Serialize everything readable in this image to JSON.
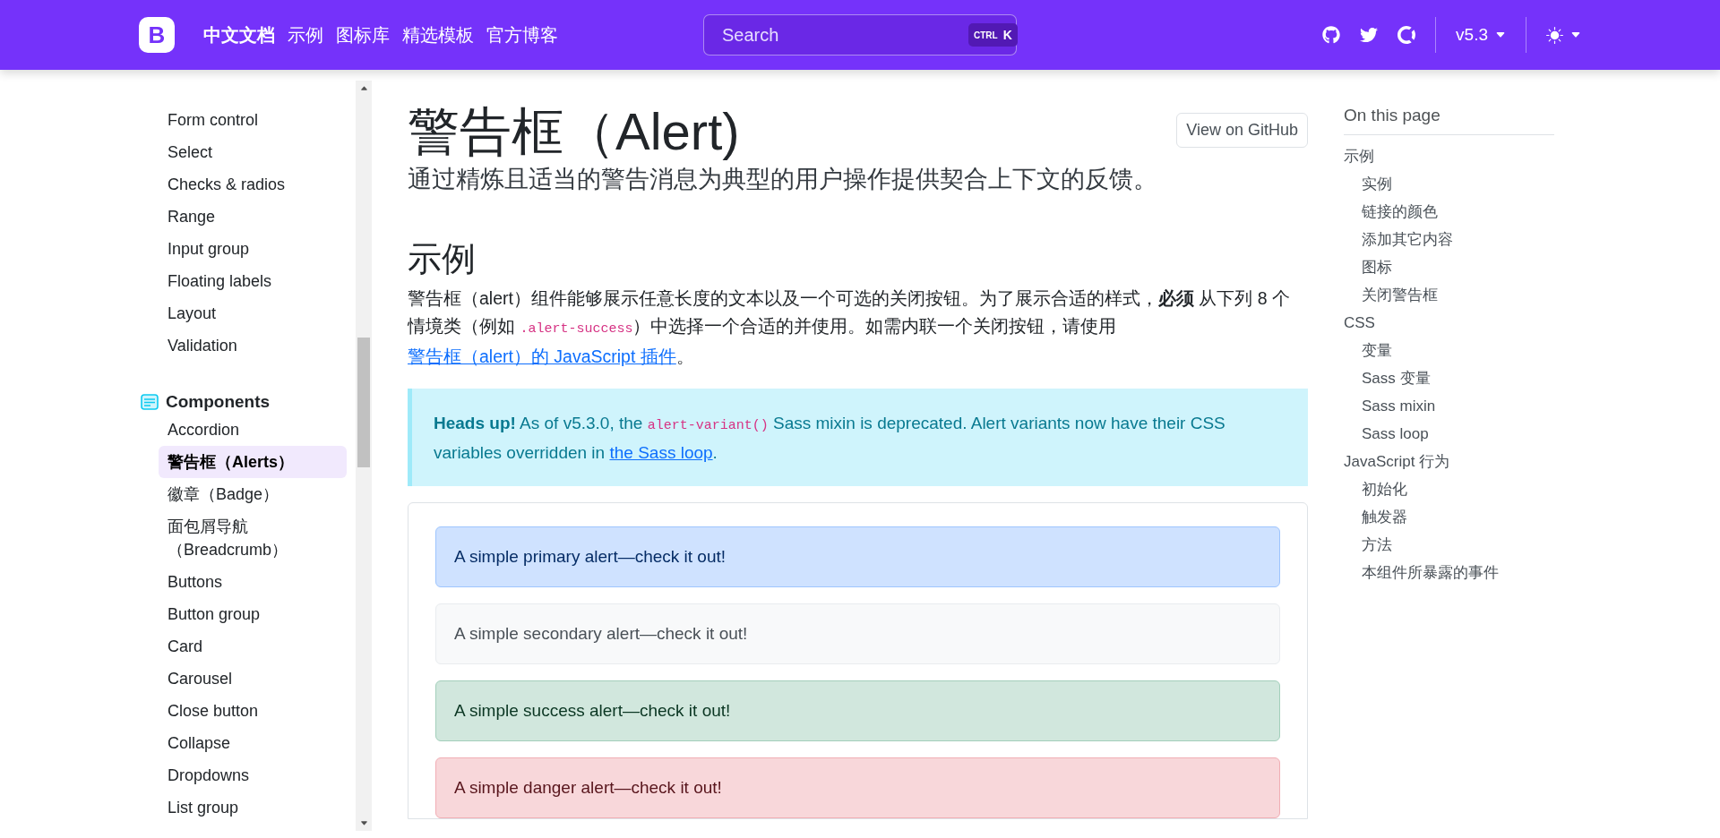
{
  "header": {
    "logo": "B",
    "brand": "中文文档",
    "nav": [
      {
        "label": "示例"
      },
      {
        "label": "图标库"
      },
      {
        "label": "精选模板"
      },
      {
        "label": "官方博客"
      }
    ],
    "search": {
      "placeholder": "Search",
      "keys": [
        "CTRL",
        "K"
      ]
    },
    "version": "v5.3"
  },
  "sidebar": {
    "sections": [
      {
        "items": [
          {
            "label": "Form control",
            "selected": false
          },
          {
            "label": "Select",
            "selected": false
          },
          {
            "label": "Checks & radios",
            "selected": false
          },
          {
            "label": "Range",
            "selected": false
          },
          {
            "label": "Input group",
            "selected": false
          },
          {
            "label": "Floating labels",
            "selected": false
          },
          {
            "label": "Layout",
            "selected": false
          },
          {
            "label": "Validation",
            "selected": false
          }
        ]
      },
      {
        "heading": "Components",
        "items": [
          {
            "label": "Accordion",
            "selected": false
          },
          {
            "label": "警告框（Alerts）",
            "selected": true
          },
          {
            "label": "徽章（Badge）",
            "selected": false
          },
          {
            "label": "面包屑导航（Breadcrumb）",
            "selected": false
          },
          {
            "label": "Buttons",
            "selected": false
          },
          {
            "label": "Button group",
            "selected": false
          },
          {
            "label": "Card",
            "selected": false
          },
          {
            "label": "Carousel",
            "selected": false
          },
          {
            "label": "Close button",
            "selected": false
          },
          {
            "label": "Collapse",
            "selected": false
          },
          {
            "label": "Dropdowns",
            "selected": false
          },
          {
            "label": "List group",
            "selected": false
          }
        ]
      }
    ]
  },
  "main": {
    "title": "警告框（Alert)",
    "github_button": "View on GitHub",
    "lead": "通过精炼且适当的警告消息为典型的用户操作提供契合上下文的反馈。",
    "section_heading": "示例",
    "paragraph": [
      {
        "kind": "text",
        "text": "警告框（alert）组件能够展示任意长度的文本以及一个可选的关闭按钮。为了展示合适的样式，"
      },
      {
        "kind": "bold",
        "text": "必须"
      },
      {
        "kind": "text",
        "text": " 从下列 8 个情境类（例如 "
      },
      {
        "kind": "code",
        "text": ".alert-success"
      },
      {
        "kind": "text",
        "text": "）中选择一个合适的并使用。如需内联一个关闭按钮，请使用 "
      },
      {
        "kind": "link",
        "text": "警告框（alert）的 JavaScript 插件"
      },
      {
        "kind": "text",
        "text": "。"
      }
    ],
    "callout": [
      {
        "kind": "bold",
        "text": "Heads up!"
      },
      {
        "kind": "text",
        "text": " As of v5.3.0, the "
      },
      {
        "kind": "code",
        "text": "alert-variant()"
      },
      {
        "kind": "text",
        "text": " Sass mixin is deprecated. Alert variants now have their CSS variables overridden in "
      },
      {
        "kind": "link",
        "text": "the Sass loop"
      },
      {
        "kind": "text",
        "text": "."
      }
    ],
    "alerts": [
      {
        "kind": "primary",
        "text": "A simple primary alert—check it out!"
      },
      {
        "kind": "secondary",
        "text": "A simple secondary alert—check it out!"
      },
      {
        "kind": "success",
        "text": "A simple success alert—check it out!"
      },
      {
        "kind": "danger",
        "text": "A simple danger alert—check it out!"
      }
    ]
  },
  "toc": {
    "title": "On this page",
    "items": [
      {
        "label": "示例",
        "children": [
          {
            "label": "实例"
          },
          {
            "label": "链接的颜色"
          },
          {
            "label": "添加其它内容"
          },
          {
            "label": "图标"
          },
          {
            "label": "关闭警告框"
          }
        ]
      },
      {
        "label": "CSS",
        "children": [
          {
            "label": "变量"
          },
          {
            "label": "Sass 变量"
          },
          {
            "label": "Sass mixin"
          },
          {
            "label": "Sass loop"
          }
        ]
      },
      {
        "label": "JavaScript 行为",
        "children": [
          {
            "label": "初始化"
          },
          {
            "label": "触发器"
          },
          {
            "label": "方法"
          },
          {
            "label": "本组件所暴露的事件"
          }
        ]
      }
    ]
  }
}
